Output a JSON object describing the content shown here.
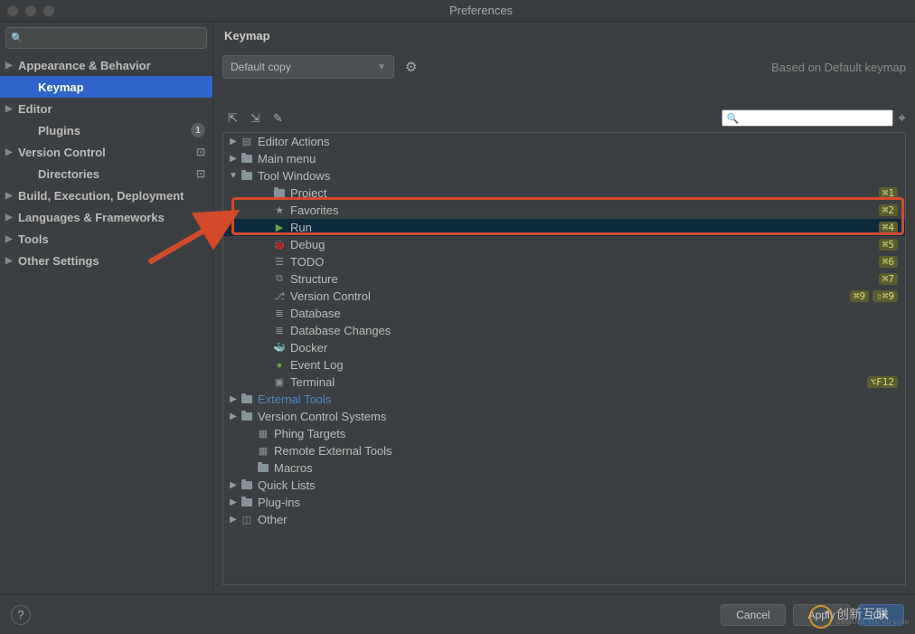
{
  "window": {
    "title": "Preferences"
  },
  "sidebar": {
    "search_placeholder": "",
    "items": [
      {
        "label": "Appearance & Behavior",
        "arrow": true,
        "bold": true
      },
      {
        "label": "Keymap",
        "selected": true,
        "child": true,
        "bold": true
      },
      {
        "label": "Editor",
        "arrow": true,
        "bold": true
      },
      {
        "label": "Plugins",
        "child": true,
        "badge": "1",
        "bold": true
      },
      {
        "label": "Version Control",
        "arrow": true,
        "ind": "⊡",
        "bold": true
      },
      {
        "label": "Directories",
        "child": true,
        "ind": "⊡",
        "bold": true
      },
      {
        "label": "Build, Execution, Deployment",
        "arrow": true,
        "bold": true
      },
      {
        "label": "Languages & Frameworks",
        "arrow": true,
        "bold": true
      },
      {
        "label": "Tools",
        "arrow": true,
        "bold": true
      },
      {
        "label": "Other Settings",
        "arrow": true,
        "bold": true
      }
    ]
  },
  "main": {
    "title": "Keymap",
    "scheme": "Default copy",
    "based_on": "Based on Default keymap",
    "tree": [
      {
        "d": 0,
        "tgl": "▶",
        "icon": "editor-actions-icon",
        "label": "Editor Actions"
      },
      {
        "d": 0,
        "tgl": "▶",
        "icon": "folder",
        "label": "Main menu"
      },
      {
        "d": 0,
        "tgl": "▼",
        "icon": "folder",
        "label": "Tool Windows"
      },
      {
        "d": 2,
        "icon": "folder",
        "label": "Project",
        "sc": [
          "⌘1"
        ]
      },
      {
        "d": 2,
        "icon": "star",
        "label": "Favorites",
        "sc": [
          "⌘2"
        ]
      },
      {
        "d": 2,
        "icon": "run",
        "label": "Run",
        "selected": true,
        "sc": [
          "⌘4"
        ]
      },
      {
        "d": 2,
        "icon": "debug",
        "label": "Debug",
        "sc": [
          "⌘5"
        ]
      },
      {
        "d": 2,
        "icon": "todo",
        "label": "TODO",
        "sc": [
          "⌘6"
        ]
      },
      {
        "d": 2,
        "icon": "structure",
        "label": "Structure",
        "sc": [
          "⌘7"
        ]
      },
      {
        "d": 2,
        "icon": "vcs",
        "label": "Version Control",
        "sc": [
          "⌘9",
          "⇧⌘9"
        ]
      },
      {
        "d": 2,
        "icon": "db",
        "label": "Database"
      },
      {
        "d": 2,
        "icon": "dbchanges",
        "label": "Database Changes"
      },
      {
        "d": 2,
        "icon": "docker",
        "label": "Docker"
      },
      {
        "d": 2,
        "icon": "event",
        "label": "Event Log"
      },
      {
        "d": 2,
        "icon": "terminal",
        "label": "Terminal",
        "sc": [
          "⌥F12"
        ]
      },
      {
        "d": 0,
        "tgl": "▶",
        "icon": "folder",
        "label": "External Tools",
        "link": true
      },
      {
        "d": 0,
        "tgl": "▶",
        "icon": "folder",
        "label": "Version Control Systems"
      },
      {
        "d": 1,
        "icon": "phing",
        "label": "Phing Targets"
      },
      {
        "d": 1,
        "icon": "remote",
        "label": "Remote External Tools"
      },
      {
        "d": 1,
        "icon": "folder",
        "label": "Macros"
      },
      {
        "d": 0,
        "tgl": "▶",
        "icon": "folder",
        "label": "Quick Lists"
      },
      {
        "d": 0,
        "tgl": "▶",
        "icon": "folder",
        "label": "Plug-ins"
      },
      {
        "d": 0,
        "tgl": "▶",
        "icon": "other",
        "label": "Other"
      }
    ]
  },
  "footer": {
    "cancel": "Cancel",
    "apply": "Apply",
    "ok": "OK"
  },
  "watermark": {
    "main": "创新互联",
    "sub": "CHUANG XIN HU LIAN"
  }
}
